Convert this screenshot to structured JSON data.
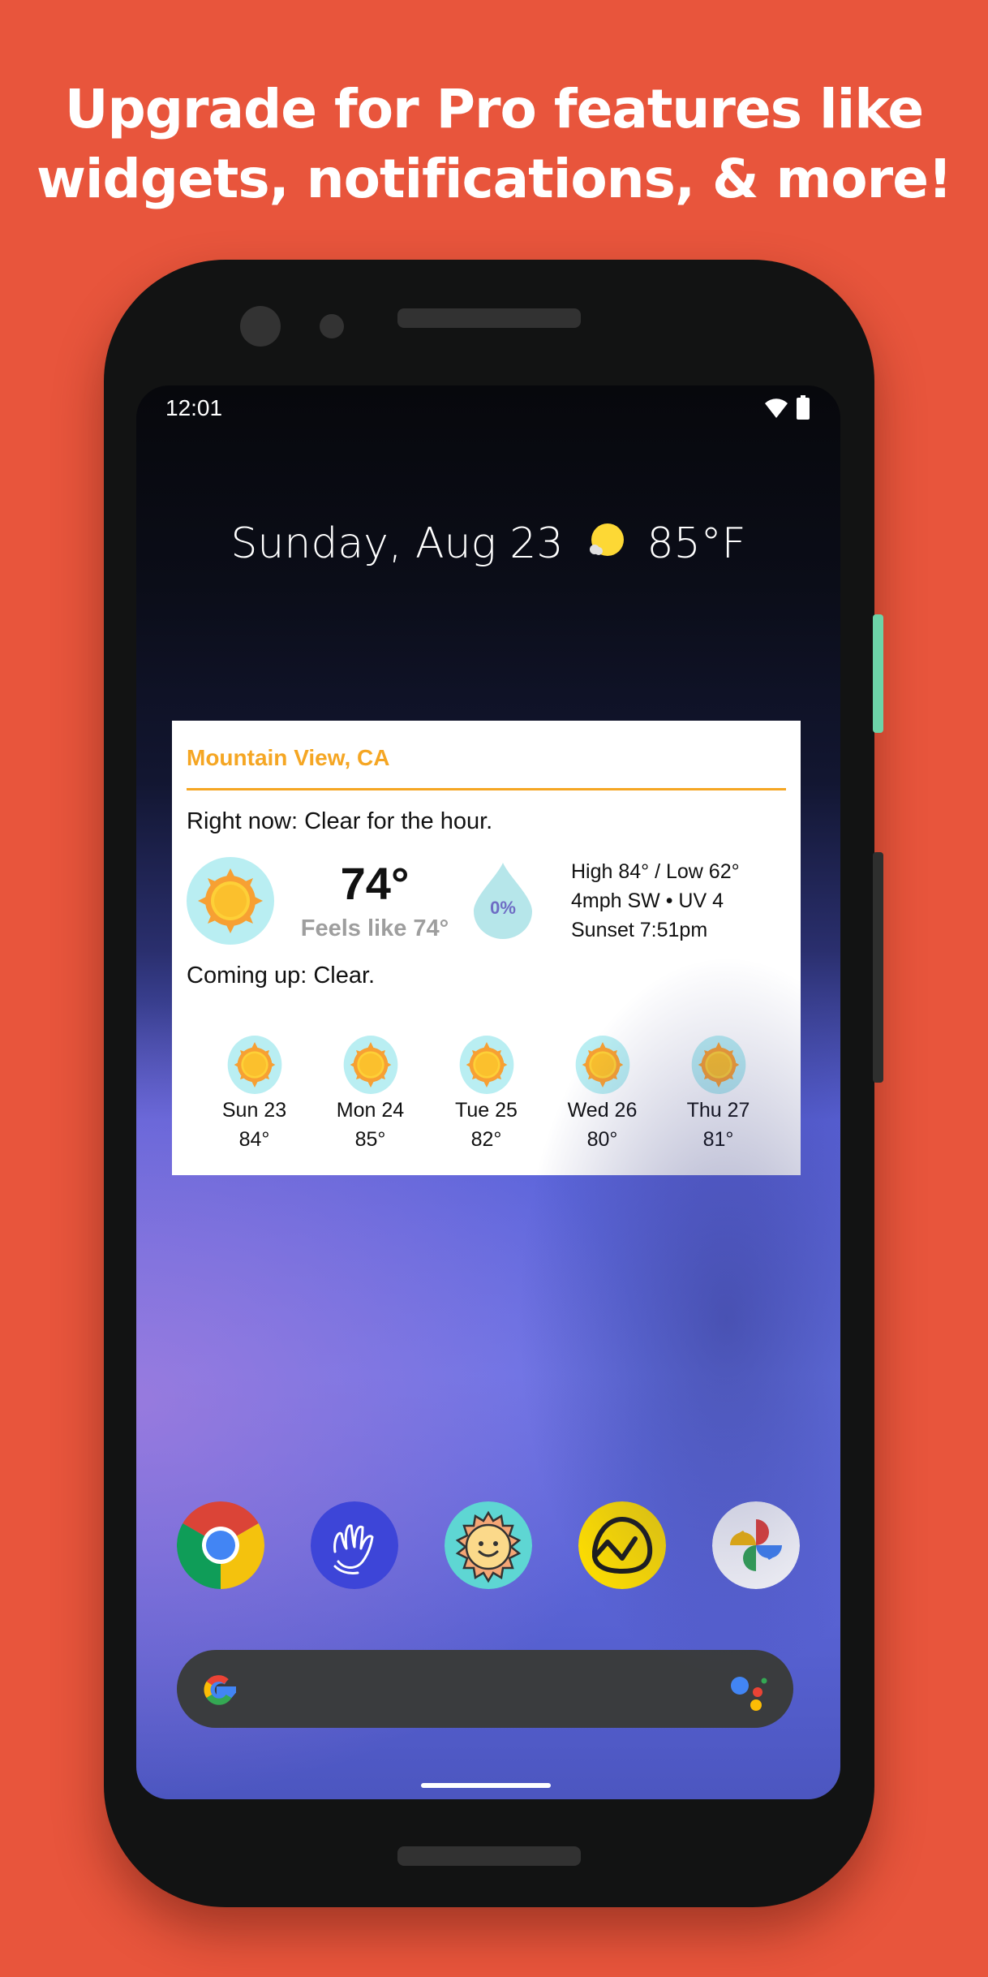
{
  "promo": {
    "headline_line1": "Upgrade for Pro features like",
    "headline_line2": "widgets, notifications, & more!"
  },
  "status_bar": {
    "time": "12:01",
    "icons": [
      "wifi-icon",
      "battery-icon"
    ]
  },
  "at_a_glance": {
    "date": "Sunday, Aug 23",
    "icon": "partly-sunny-icon",
    "temperature": "85°F"
  },
  "widget": {
    "location": "Mountain View, CA",
    "right_now": "Right now: Clear for the hour.",
    "current_icon": "sun-icon",
    "current_temp": "74°",
    "feels_like": "Feels like 74°",
    "precip_chance": "0%",
    "details": [
      "High 84° / Low 62°",
      "4mph SW • UV 4",
      "Sunset 7:51pm"
    ],
    "coming_up": "Coming up: Clear.",
    "forecast": [
      {
        "day": "Sun 23",
        "temp": "84°",
        "icon": "sun-icon"
      },
      {
        "day": "Mon 24",
        "temp": "85°",
        "icon": "sun-icon"
      },
      {
        "day": "Tue 25",
        "temp": "82°",
        "icon": "sun-icon"
      },
      {
        "day": "Wed 26",
        "temp": "80°",
        "icon": "sun-icon"
      },
      {
        "day": "Thu 27",
        "temp": "81°",
        "icon": "sun-icon"
      }
    ],
    "accent_color": "#F5A623"
  },
  "dock": {
    "apps": [
      {
        "name": "chrome",
        "icon": "chrome-icon"
      },
      {
        "name": "hand-wave-app",
        "icon": "hand-icon"
      },
      {
        "name": "weather-app",
        "icon": "smiling-sun-icon"
      },
      {
        "name": "basecamp",
        "icon": "basecamp-icon"
      },
      {
        "name": "google-photos",
        "icon": "pinwheel-icon"
      }
    ]
  },
  "search_bar": {
    "left_icon": "google-g-icon",
    "right_icon": "assistant-icon"
  },
  "colors": {
    "background": "#E8553C",
    "phone_body": "#121313",
    "power_button": "#6DD3A8",
    "search_bar": "#3A3C3E"
  }
}
